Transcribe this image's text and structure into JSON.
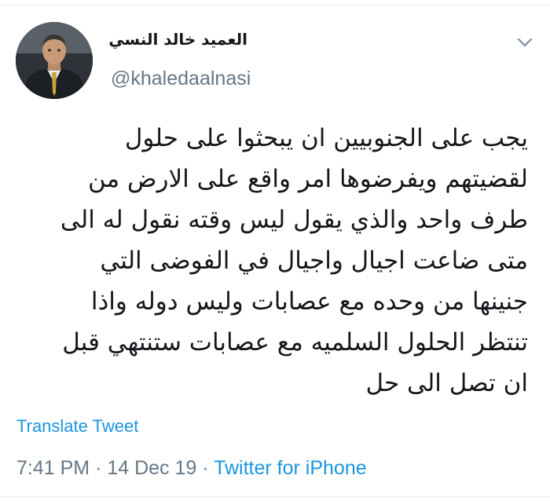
{
  "tweet": {
    "author": {
      "display_name": "العميد خالد النسي",
      "handle": "@khaledaalnasi",
      "avatar_icon": "profile-photo"
    },
    "menu_icon": "chevron-down-icon",
    "text_lines": [
      "يجب على الجنوبيين ان يبحثوا على حلول",
      "لقضيتهم ويفرضوها امر واقع على الارض من",
      "طرف واحد والذي يقول ليس وقته نقول له الى",
      "متى ضاعت اجيال واجيال في الفوضى التي",
      "جنينها من وحده مع عصابات وليس دوله واذا",
      "تنتظر الحلول السلميه مع عصابات ستنتهي قبل",
      "ان تصل الى حل"
    ],
    "translate_label": "Translate Tweet",
    "time": "7:41 PM",
    "date": "14 Dec 19",
    "separator": "·",
    "source": "Twitter for iPhone"
  },
  "colors": {
    "link": "#1b95e0",
    "secondary_text": "#657786",
    "primary_text": "#14171a",
    "divider": "#e6ecf0"
  }
}
